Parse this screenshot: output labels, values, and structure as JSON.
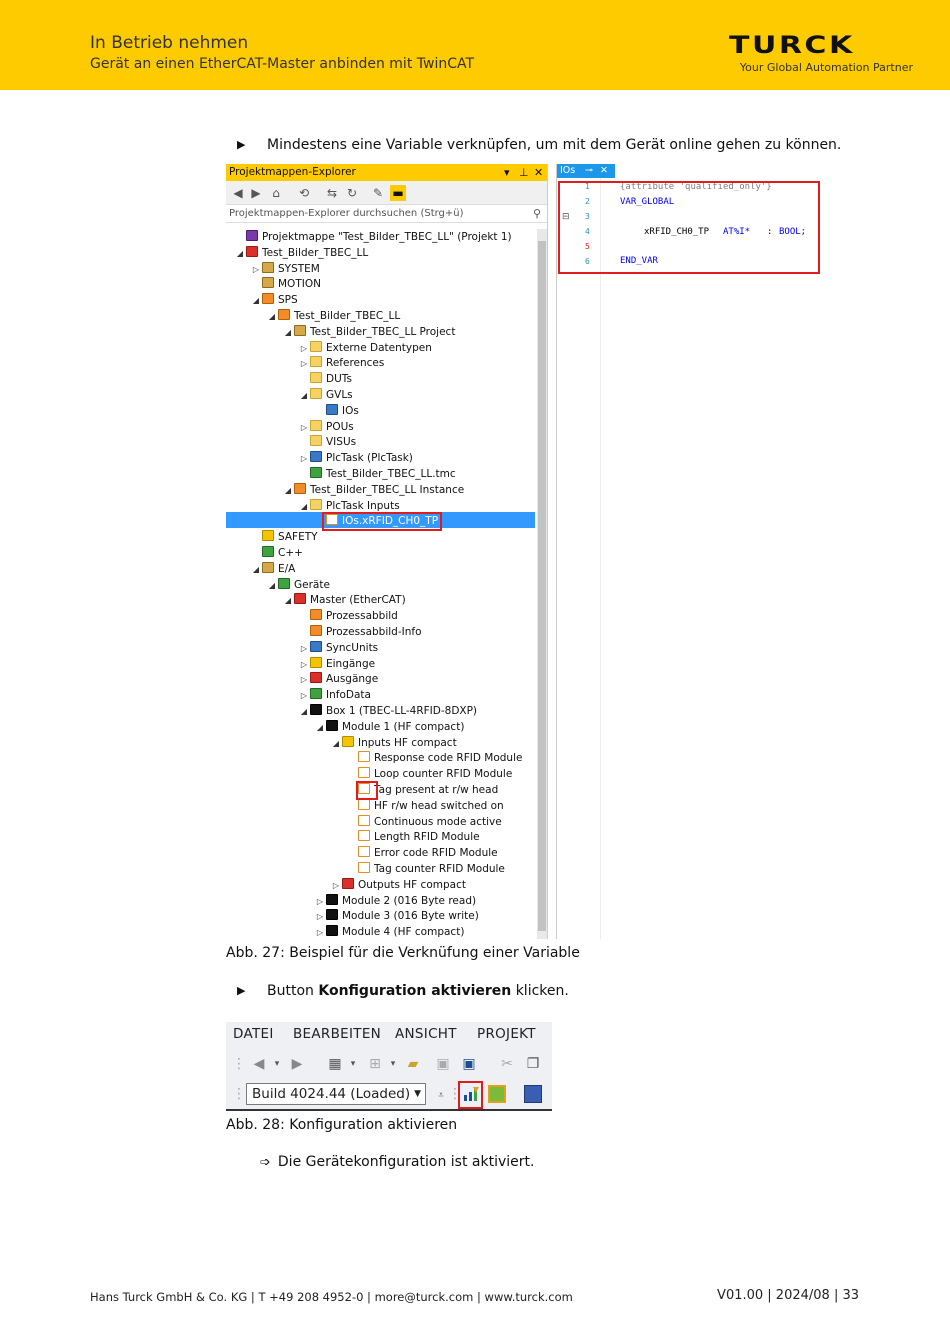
{
  "header": {
    "title": "In Betrieb nehmen",
    "subtitle": "Gerät an einen EtherCAT-Master anbinden mit TwinCAT",
    "logo": "TURCK",
    "tagline": "Your Global Automation Partner"
  },
  "step1": "Mindestens eine Variable verknüpfen, um mit dem Gerät online gehen zu können.",
  "step2_pre": "Button ",
  "step2_bold": "Konfiguration aktivieren",
  "step2_post": " klicken.",
  "bullet": "▶",
  "result_arrow": "➩",
  "result": "Die Gerätekonfiguration ist aktiviert.",
  "caption27": "Abb. 27: Beispiel für die Verknüfung einer Variable",
  "caption28": "Abb. 28: Konfiguration aktivieren",
  "explorer": {
    "title": "Projektmappen-Explorer",
    "title_controls": [
      "▾",
      "⊥",
      "✕"
    ],
    "search_placeholder": "Projektmappen-Explorer durchsuchen (Strg+ü)",
    "nodes": [
      {
        "label": "Projektmappe \"Test_Bilder_TBEC_LL\" (Projekt 1)",
        "icon": "sol",
        "toggle": ""
      },
      {
        "label": "Test_Bilder_TBEC_LL",
        "icon": "red",
        "toggle": "◢"
      },
      {
        "label": "SYSTEM",
        "icon": "sys",
        "toggle": "▷"
      },
      {
        "label": "MOTION",
        "icon": "sys",
        "toggle": ""
      },
      {
        "label": "SPS",
        "icon": "orange",
        "toggle": "◢"
      },
      {
        "label": "Test_Bilder_TBEC_LL",
        "icon": "orange",
        "toggle": "◢"
      },
      {
        "label": "Test_Bilder_TBEC_LL Project",
        "icon": "sys",
        "toggle": "◢"
      },
      {
        "label": "Externe Datentypen",
        "icon": "folder",
        "toggle": "▷"
      },
      {
        "label": "References",
        "icon": "folder",
        "toggle": "▷"
      },
      {
        "label": "DUTs",
        "icon": "folder",
        "toggle": ""
      },
      {
        "label": "GVLs",
        "icon": "folder",
        "toggle": "◢"
      },
      {
        "label": "IOs",
        "icon": "blue",
        "toggle": ""
      },
      {
        "label": "POUs",
        "icon": "folder",
        "toggle": "▷"
      },
      {
        "label": "VISUs",
        "icon": "folder",
        "toggle": ""
      },
      {
        "label": "PlcTask (PlcTask)",
        "icon": "blue",
        "toggle": "▷"
      },
      {
        "label": "Test_Bilder_TBEC_LL.tmc",
        "icon": "green",
        "toggle": ""
      },
      {
        "label": "Test_Bilder_TBEC_LL Instance",
        "icon": "orange",
        "toggle": "◢"
      },
      {
        "label": "PlcTask Inputs",
        "icon": "folder",
        "toggle": "◢"
      },
      {
        "label": "IOs.xRFID_CH0_TP",
        "icon": "var",
        "toggle": ""
      },
      {
        "label": "SAFETY",
        "icon": "yellow",
        "toggle": ""
      },
      {
        "label": "C++",
        "icon": "green",
        "toggle": ""
      },
      {
        "label": "E/A",
        "icon": "sys",
        "toggle": "◢"
      },
      {
        "label": "Geräte",
        "icon": "green",
        "toggle": "◢"
      },
      {
        "label": "Master (EtherCAT)",
        "icon": "red",
        "toggle": "◢"
      },
      {
        "label": "Prozessabbild",
        "icon": "orange",
        "toggle": ""
      },
      {
        "label": "Prozessabbild-Info",
        "icon": "orange",
        "toggle": ""
      },
      {
        "label": "SyncUnits",
        "icon": "blue",
        "toggle": "▷"
      },
      {
        "label": "Eingänge",
        "icon": "yellow",
        "toggle": "▷"
      },
      {
        "label": "Ausgänge",
        "icon": "red",
        "toggle": "▷"
      },
      {
        "label": "InfoData",
        "icon": "green",
        "toggle": "▷"
      },
      {
        "label": "Box 1 (TBEC-LL-4RFID-8DXP)",
        "icon": "box",
        "toggle": "◢"
      },
      {
        "label": "Module 1 (HF compact)",
        "icon": "box",
        "toggle": "◢"
      },
      {
        "label": "Inputs HF compact",
        "icon": "yellow",
        "toggle": "◢"
      },
      {
        "label": "Response code RFID Module",
        "icon": "var",
        "toggle": ""
      },
      {
        "label": "Loop counter RFID Module",
        "icon": "var",
        "toggle": ""
      },
      {
        "label": "Tag present at r/w head",
        "icon": "var",
        "toggle": ""
      },
      {
        "label": "HF r/w head switched on",
        "icon": "var",
        "toggle": ""
      },
      {
        "label": "Continuous mode active",
        "icon": "var",
        "toggle": ""
      },
      {
        "label": "Length RFID Module",
        "icon": "var",
        "toggle": ""
      },
      {
        "label": "Error code RFID Module",
        "icon": "var",
        "toggle": ""
      },
      {
        "label": "Tag counter RFID Module",
        "icon": "var",
        "toggle": ""
      },
      {
        "label": "Outputs HF compact",
        "icon": "red",
        "toggle": "▷"
      },
      {
        "label": "Module 2 (016 Byte read)",
        "icon": "box",
        "toggle": "▷"
      },
      {
        "label": "Module 3 (016 Byte write)",
        "icon": "box",
        "toggle": "▷"
      },
      {
        "label": "Module 4 (HF compact)",
        "icon": "box",
        "toggle": "▷"
      }
    ]
  },
  "editor": {
    "tab": "IOs",
    "tab_pin": "⊸",
    "tab_close": "✕",
    "fold_marker": "⊟",
    "line_numbers": [
      "1",
      "2",
      "3",
      "4",
      "5",
      "6"
    ],
    "line1": "{attribute 'qualified_only'}",
    "line2": "VAR_GLOBAL",
    "line4_name": "xRFID_CH0_TP",
    "line4_at": "AT%I*",
    "line4_colon": ":",
    "line4_type": "BOOL;",
    "line6": "END_VAR",
    "colors": {
      "keyword": "#0000ff",
      "comment": "#808080",
      "text": "#000000"
    }
  },
  "toolbar": {
    "menus": [
      "DATEI",
      "BEARBEITEN",
      "ANSICHT",
      "PROJEKT"
    ],
    "build": "Build 4024.44 (Loaded)"
  },
  "footer": {
    "left": "Hans Turck GmbH & Co. KG | T +49 208 4952-0 | more@turck.com | www.turck.com",
    "right": "V01.00 | 2024/08 | 33"
  }
}
